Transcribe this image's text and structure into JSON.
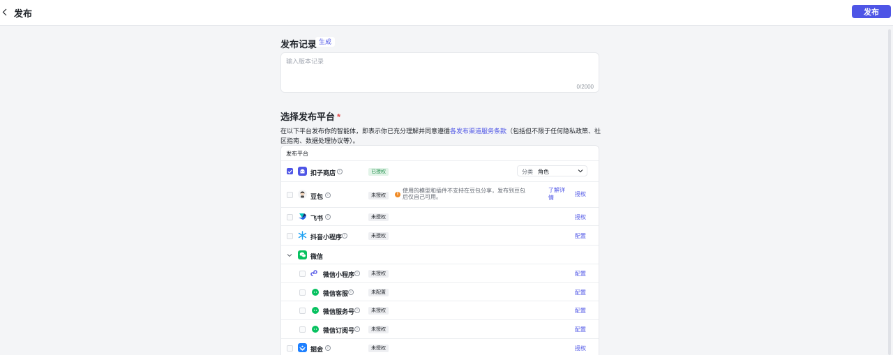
{
  "header": {
    "title": "发布",
    "publish_label": "发布"
  },
  "record": {
    "title": "发布记录",
    "generate_label": "生成",
    "placeholder": "输入版本记录",
    "counter": "0/2000"
  },
  "platform": {
    "title": "选择发布平台",
    "required_mark": "*",
    "desc_prefix": "在以下平台发布你的智能体，即表示你已充分理解并同意遵循",
    "desc_link": "各发布渠道服务条款",
    "desc_suffix": "（包括但不限于任何隐私政策、社区指南、数据处理协议等）。",
    "column_header": "发布平台"
  },
  "rows": {
    "coze_store": {
      "name": "扣子商店",
      "status": "已授权",
      "category_label": "分类",
      "category_value": "角色",
      "checked": true
    },
    "doubao": {
      "name": "豆包",
      "status": "未授权",
      "warning": "使用的模型和插件不支持在豆包分享，发布到豆包后仅自己可用。",
      "learn_more": "了解详情",
      "action": "授权"
    },
    "feishu": {
      "name": "飞书",
      "status": "未授权",
      "action": "授权"
    },
    "douyin": {
      "name": "抖音小程序",
      "status": "未授权",
      "action": "配置"
    },
    "wechat": {
      "name": "微信"
    },
    "wx_mini": {
      "name": "微信小程序",
      "status": "未授权",
      "action": "配置"
    },
    "wx_service": {
      "name": "微信客服",
      "status": "未配置",
      "action": "配置"
    },
    "wx_official": {
      "name": "微信服务号",
      "status": "未授权",
      "action": "配置"
    },
    "wx_subscribe": {
      "name": "微信订阅号",
      "status": "未授权",
      "action": "配置"
    },
    "juejin": {
      "name": "掘金",
      "status": "未授权",
      "action": "授权"
    }
  },
  "colors": {
    "accent": "#4e55e6",
    "success": "#1f8e4a",
    "warning": "#f08a24",
    "wechat": "#07c160"
  }
}
